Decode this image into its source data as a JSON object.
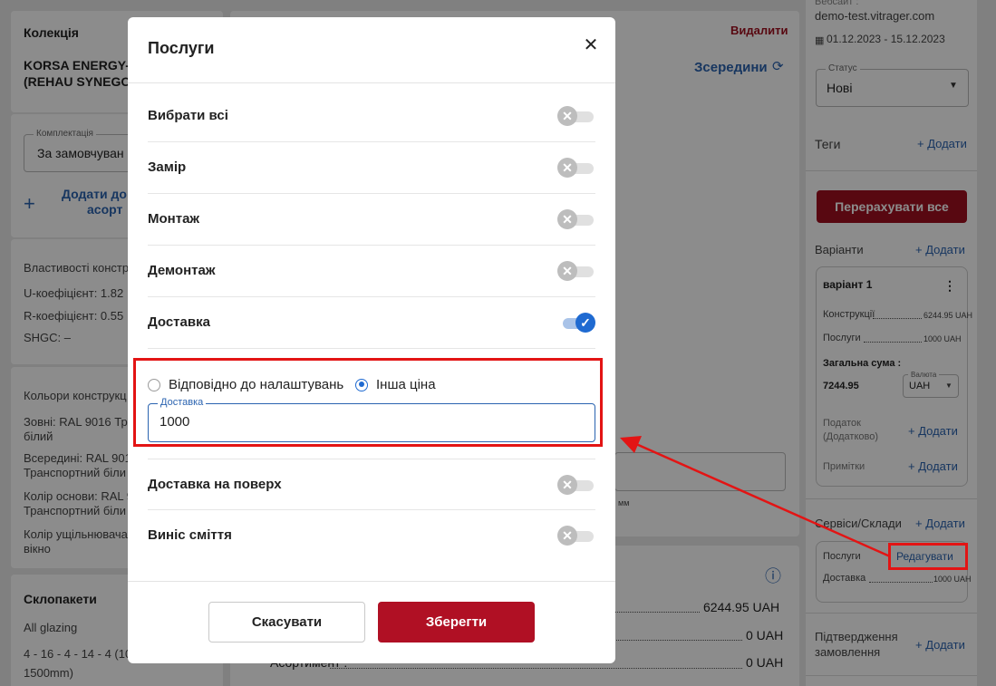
{
  "left_panel": {
    "collection_title": "Колекція",
    "collection_name_line1": "KORSA ENERGY-",
    "collection_name_line2": "(REHAU SYNEGO",
    "kit_legend": "Комплектація",
    "kit_value": "За замовчуван",
    "add_assort_line1": "Додати до",
    "add_assort_line2": "асорт",
    "properties_title": "Властивості констр",
    "u_coef": "U-коефіцієнт: 1.82",
    "r_coef": "R-коефіцієнт: 0.55",
    "shgc": "SHGC: –",
    "colors_title": "Кольори конструкц",
    "outside_a": "Зовні: RAL 9016 Тр",
    "outside_b": "білий",
    "inside_a": "Всередині: RAL 901",
    "inside_b": "Транспортний біли",
    "base_a": "Колір основи: RAL 9",
    "base_b": "Транспортний біли",
    "seal_a": "Колір ущільнювача",
    "seal_b": "вікно",
    "glazing_title": "Склопакети",
    "all_glazing": "All glazing",
    "glazing_a": "4 - 16 - 4 - 14 - 4 (100",
    "glazing_b": "1500mm)"
  },
  "middle_panel": {
    "delete_label": "Видалити",
    "inside_label": "Зсередини",
    "mm_label": "мм",
    "price1": "6244.95 UAH",
    "price2": "0 UAH",
    "price3": "0 UAH",
    "assortment_label": "Асортимент :"
  },
  "right_panel": {
    "site_label": "Вебсайт :",
    "site": "demo-test.vitrager.com",
    "dates": "01.12.2023 - 15.12.2023",
    "status_legend": "Статус",
    "status_value": "Нові",
    "tags_label": "Теги",
    "add_label": "+ Додати",
    "recalc_label": "Перерахувати все",
    "variants_label": "Варіанти",
    "variant_name": "варіант 1",
    "constructions_label": "Конструкції",
    "constructions_value": "6244.95 UAH",
    "services_label": "Послуги",
    "services_value": "1000 UAH",
    "total_label": "Загальна сума :",
    "total_value": "7244.95",
    "currency_legend": "Валюта",
    "currency_value": "UAH",
    "tax_line1": "Податок",
    "tax_line2": "(Додатково)",
    "notes_label": "Примітки",
    "services_storages": "Сервіси/Склади",
    "services_card_label": "Послуги",
    "edit_label": "Редагувати",
    "delivery_label": "Доставка",
    "delivery_value": "1000 UAH",
    "confirm_line1": "Підтвердження",
    "confirm_line2": "замовлення"
  },
  "modal": {
    "title": "Послуги",
    "close_icon": "close-icon",
    "services": [
      {
        "label": "Вибрати всі",
        "on": false
      },
      {
        "label": "Замір",
        "on": false
      },
      {
        "label": "Монтаж",
        "on": false
      },
      {
        "label": "Демонтаж",
        "on": false
      },
      {
        "label": "Доставка",
        "on": true
      },
      {
        "label": "Доставка на поверх",
        "on": false
      },
      {
        "label": "Винiс сміття",
        "on": false
      }
    ],
    "radio_default": "Відповідно до налаштувань",
    "radio_custom": "Інша ціна",
    "radio_selected": "custom",
    "price_legend": "Доставка",
    "price_value": "1000",
    "cancel_label": "Скасувати",
    "save_label": "Зберегти"
  },
  "colors": {
    "brand_red": "#b01024",
    "link_blue": "#2a63b0",
    "toggle_on": "#1f6ad1",
    "annotation_red": "#e31414"
  }
}
